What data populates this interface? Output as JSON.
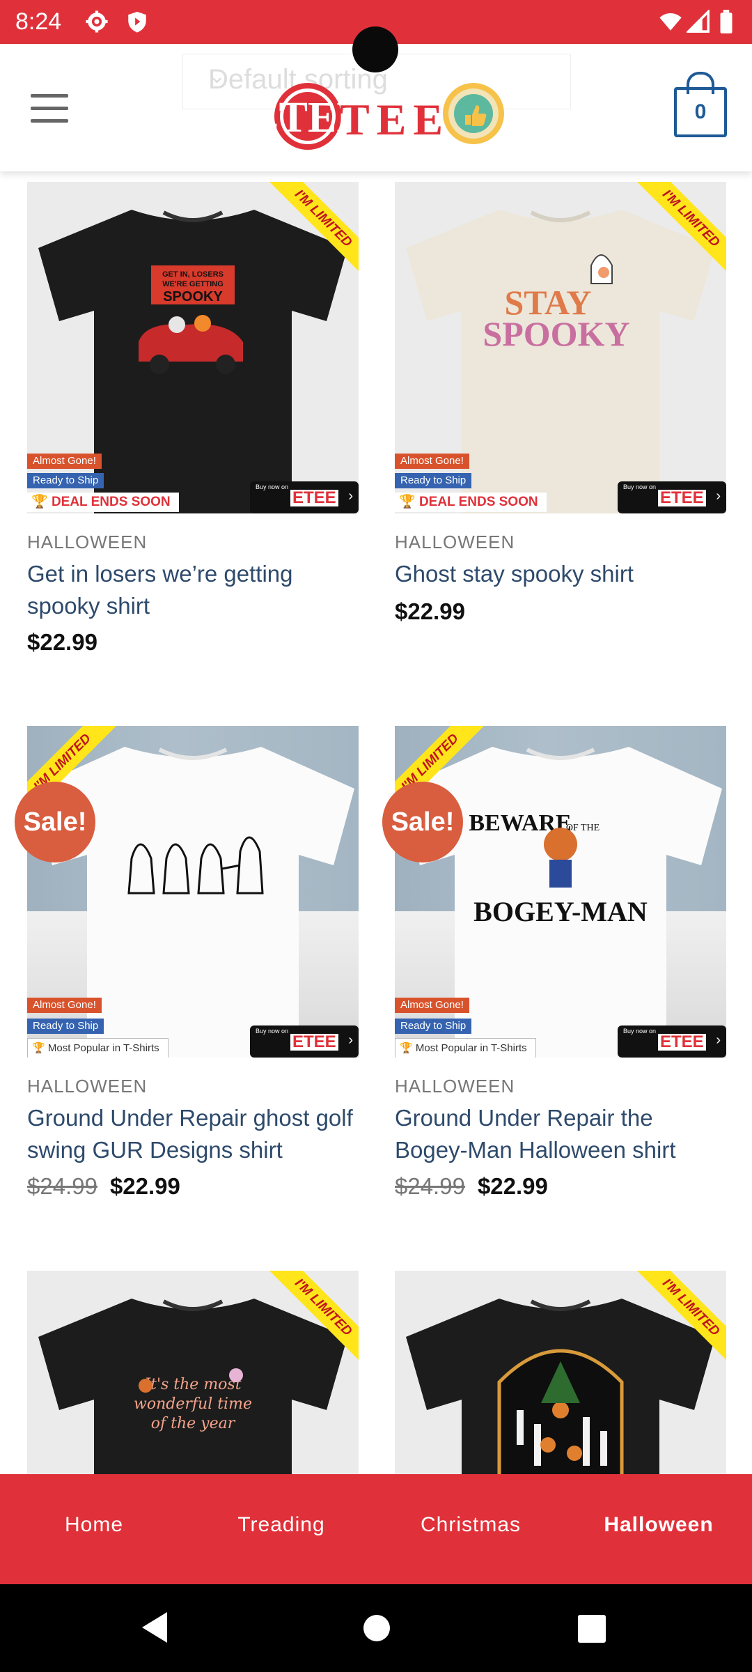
{
  "status_bar": {
    "time": "8:24"
  },
  "header": {
    "sort_placeholder": "Default sorting",
    "logo_text": "ETEE",
    "cart_count": "0"
  },
  "products": [
    {
      "category": "HALLOWEEN",
      "name": "Get in losers we’re getting spooky shirt",
      "price": "$22.99",
      "old_price": "",
      "ribbon": "I'M LIMITED",
      "tags": [
        "Almost Gone!",
        "Ready to Ship"
      ],
      "strip": "DEAL ENDS SOON",
      "buy_now": "Buy now on",
      "shirt_color": "#1c1c1c",
      "print_text": [
        "GET IN, LOSERS",
        "WE'RE GETTING",
        "SPOOKY"
      ]
    },
    {
      "category": "HALLOWEEN",
      "name": "Ghost stay spooky shirt",
      "price": "$22.99",
      "old_price": "",
      "ribbon": "I'M LIMITED",
      "tags": [
        "Almost Gone!",
        "Ready to Ship"
      ],
      "strip": "DEAL ENDS SOON",
      "buy_now": "Buy now on",
      "shirt_color": "#ece7da",
      "print_text": [
        "STAY",
        "SPOOKY"
      ]
    },
    {
      "category": "HALLOWEEN",
      "name": "Ground Under Repair ghost golf swing GUR Designs shirt",
      "price": "$22.99",
      "old_price": "$24.99",
      "sale": "Sale!",
      "ribbon": "I'M LIMITED",
      "tags": [
        "Almost Gone!",
        "Ready to Ship"
      ],
      "strip": "Most Popular in T-Shirts",
      "buy_now": "Buy now on",
      "shirt_color": "#ffffff",
      "print_text": []
    },
    {
      "category": "HALLOWEEN",
      "name": "Ground Under Repair the Bogey-Man Halloween shirt",
      "price": "$22.99",
      "old_price": "$24.99",
      "sale": "Sale!",
      "ribbon": "I'M LIMITED",
      "tags": [
        "Almost Gone!",
        "Ready to Ship"
      ],
      "strip": "Most Popular in T-Shirts",
      "buy_now": "Buy now on",
      "shirt_color": "#ffffff",
      "print_text": [
        "BEWARE",
        "OF THE",
        "BOGEY-MAN"
      ]
    },
    {
      "ribbon": "I'M LIMITED",
      "shirt_color": "#1c1c1c",
      "print_text": [
        "It's the most",
        "wonderful time",
        "of the year"
      ]
    },
    {
      "ribbon": "I'M LIMITED",
      "shirt_color": "#1c1c1c",
      "print_text": []
    }
  ],
  "bottom_nav": [
    {
      "label": "Home",
      "active": false
    },
    {
      "label": "Treading",
      "active": false
    },
    {
      "label": "Christmas",
      "active": false
    },
    {
      "label": "Halloween",
      "active": true
    }
  ],
  "colors": {
    "brand_red": "#e0313a",
    "link_blue": "#2e4a6b",
    "sale_orange": "#d95d3f",
    "cart_blue": "#1e5a96"
  }
}
